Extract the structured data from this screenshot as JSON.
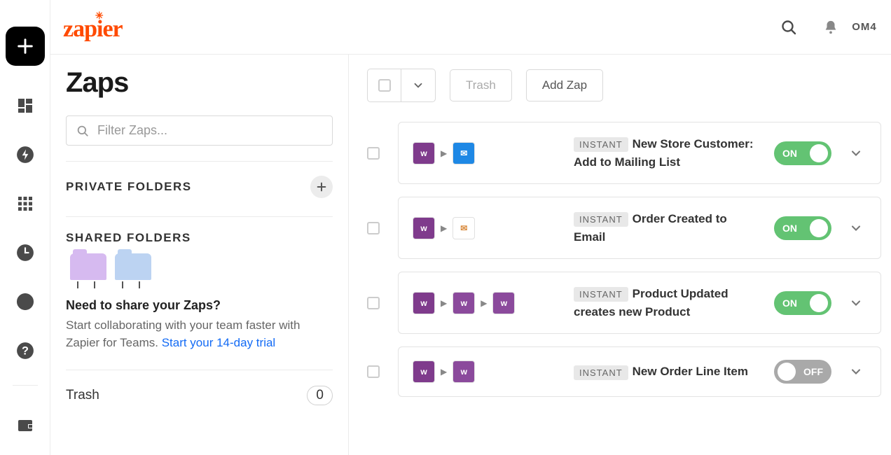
{
  "header": {
    "logo": "zapier",
    "avatar": "OM4"
  },
  "sidebar": {
    "title": "Zaps",
    "filter_placeholder": "Filter Zaps...",
    "private_folders_label": "PRIVATE FOLDERS",
    "shared_folders_label": "SHARED FOLDERS",
    "share_title": "Need to share your Zaps?",
    "share_text": "Start collaborating with your team faster with Zapier for Teams. ",
    "share_link": "Start your 14-day trial",
    "trash_label": "Trash",
    "trash_count": "0"
  },
  "toolbar": {
    "trash_btn": "Trash",
    "add_btn": "Add Zap"
  },
  "toggle_labels": {
    "on": "ON",
    "off": "OFF"
  },
  "zaps": [
    {
      "badge": "INSTANT",
      "name": "New Store Customer: Add to Mailing List",
      "on": true
    },
    {
      "badge": "INSTANT",
      "name": "Order Created to Email",
      "on": true
    },
    {
      "badge": "INSTANT",
      "name": "Product Updated creates new Product",
      "on": true
    },
    {
      "badge": "INSTANT",
      "name": "New Order Line Item",
      "on": false
    }
  ]
}
